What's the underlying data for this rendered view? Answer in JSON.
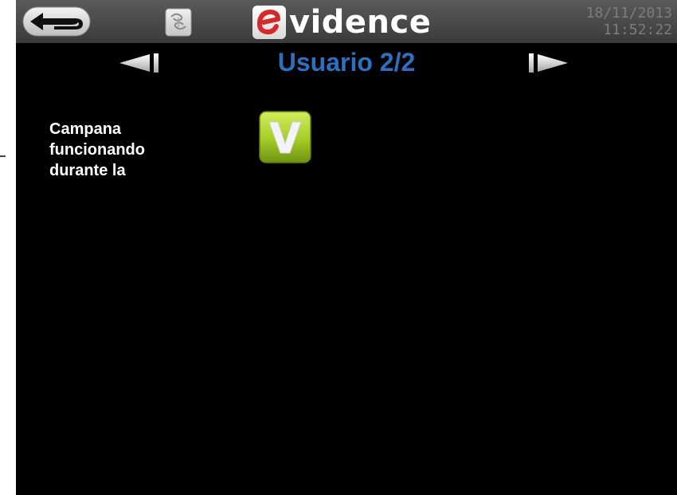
{
  "colors": {
    "screen_background": "#000000",
    "title_blue": "#2f6fbf",
    "datetime_gray": "#7c7c7c",
    "logo_red": "#d42a2a",
    "check_green": "#a4cc26"
  },
  "header": {
    "back_icon": "back-arrow-icon",
    "fan_icon": "fan-icon",
    "logo_text": "vidence",
    "logo_initial": "e",
    "date": "18/11/2013",
    "time": "11:52:22"
  },
  "navigation": {
    "prev_icon": "arrow-left-icon",
    "next_icon": "arrow-right-icon",
    "title": "Usuario 2/2"
  },
  "item": {
    "label_lines": [
      "Campana",
      "funcionando",
      "durante la"
    ],
    "check_label": "V",
    "check_icon": "check-v-icon"
  }
}
